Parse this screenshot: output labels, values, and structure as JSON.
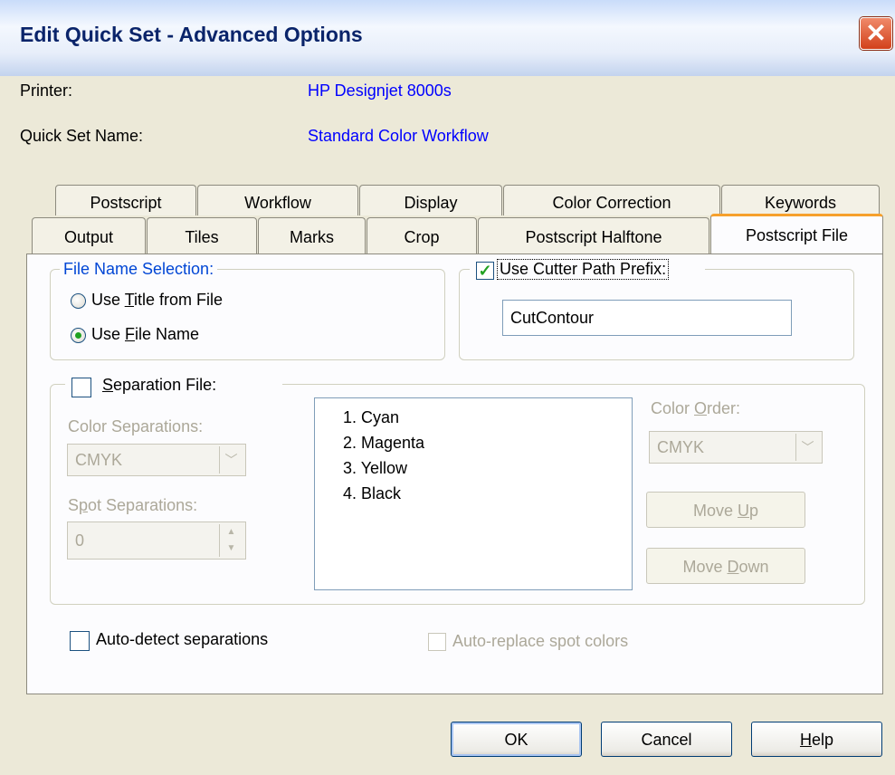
{
  "window": {
    "title": "Edit Quick Set - Advanced Options",
    "close_glyph": "✕"
  },
  "info": {
    "printer_label": "Printer:",
    "printer_value": "HP Designjet 8000s",
    "quickset_label": "Quick Set Name:",
    "quickset_value": "Standard Color Workflow"
  },
  "tabs": {
    "row1": [
      "Postscript",
      "Workflow",
      "Display",
      "Color Correction",
      "Keywords"
    ],
    "row2": [
      "Output",
      "Tiles",
      "Marks",
      "Crop",
      "Postscript Halftone",
      "Postscript File"
    ],
    "selected": "Postscript File"
  },
  "file_name": {
    "group_title": "File Name Selection:",
    "option1_pre": "Use ",
    "option1_ul": "T",
    "option1_post": "itle from File",
    "option2_pre": "Use ",
    "option2_ul": "F",
    "option2_post": "ile Name",
    "selected": "Use File Name"
  },
  "cutter": {
    "label": "Use Cutter Path Prefix:",
    "checked": true,
    "value": "CutContour"
  },
  "separation": {
    "label_ul": "S",
    "label_rest": "eparation File:",
    "checked": false,
    "color_sep_label": "Color Separations:",
    "color_sep_value": "CMYK",
    "spot_sep_label_ul": "p",
    "spot_sep_label_pre": "S",
    "spot_sep_label_post": "ot Separations:",
    "spot_sep_value": "0",
    "list": [
      "1. Cyan",
      "2. Magenta",
      "3. Yellow",
      "4. Black"
    ],
    "color_order_label_pre": "Color ",
    "color_order_label_ul": "O",
    "color_order_label_post": "rder:",
    "color_order_value": "CMYK",
    "move_up_pre": "Move ",
    "move_up_ul": "U",
    "move_up_post": "p",
    "move_down_pre": "Move ",
    "move_down_ul": "D",
    "move_down_post": "own"
  },
  "auto_detect": {
    "label": "Auto-detect separations",
    "checked": false
  },
  "auto_replace": {
    "label": "Auto-replace spot colors",
    "checked": false
  },
  "buttons": {
    "ok": "OK",
    "cancel": "Cancel",
    "help_ul": "H",
    "help_rest": "elp"
  },
  "colors": {
    "accent_tab": "#F6A02C",
    "value_text": "#0000FF",
    "title_text": "#0A246A"
  }
}
